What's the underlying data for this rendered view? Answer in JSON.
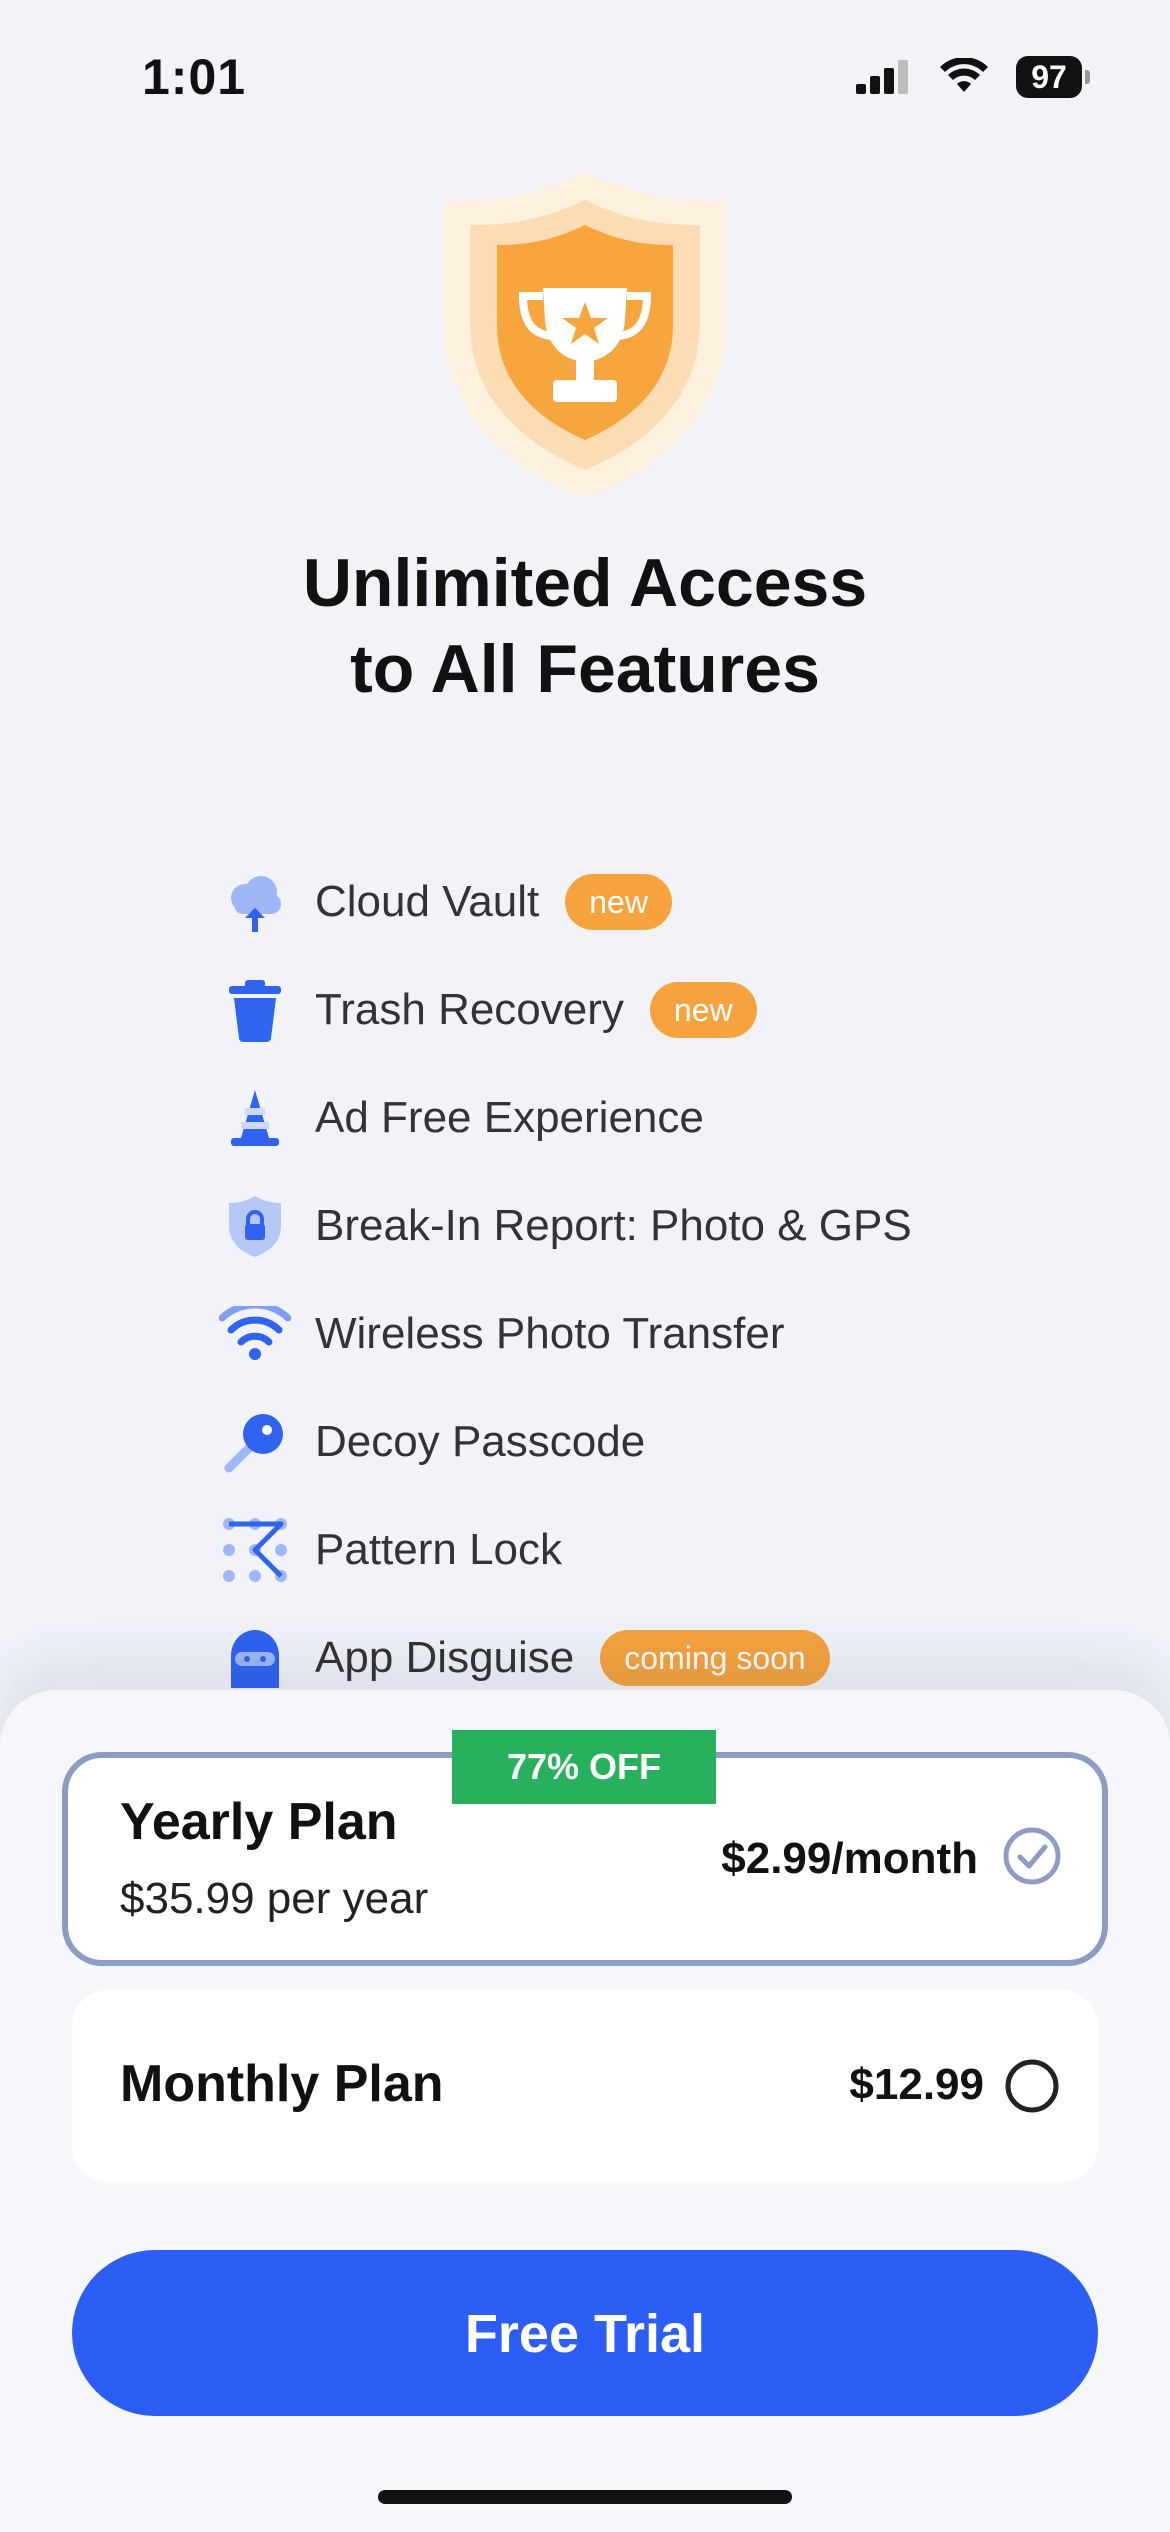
{
  "status_bar": {
    "time": "1:01",
    "battery": "97"
  },
  "headline": {
    "line1": "Unlimited Access",
    "line2": "to All Features"
  },
  "features": [
    {
      "label": "Cloud Vault",
      "badge": "new",
      "icon": "cloud-upload-icon"
    },
    {
      "label": "Trash Recovery",
      "badge": "new",
      "icon": "trash-icon"
    },
    {
      "label": "Ad Free Experience",
      "badge": "",
      "icon": "traffic-cone-icon"
    },
    {
      "label": "Break-In Report: Photo & GPS",
      "badge": "",
      "icon": "shield-lock-icon"
    },
    {
      "label": "Wireless Photo Transfer",
      "badge": "",
      "icon": "wifi-icon"
    },
    {
      "label": "Decoy Passcode",
      "badge": "",
      "icon": "key-icon"
    },
    {
      "label": "Pattern Lock",
      "badge": "",
      "icon": "pattern-lock-icon"
    },
    {
      "label": "App Disguise",
      "badge": "coming soon",
      "icon": "disguise-mask-icon"
    }
  ],
  "plans": {
    "yearly": {
      "badge": "77% OFF",
      "title": "Yearly Plan",
      "subtitle": "$35.99 per year",
      "price": "$2.99/month",
      "selected": true
    },
    "monthly": {
      "title": "Monthly Plan",
      "price": "$12.99",
      "selected": false
    }
  },
  "cta": {
    "label": "Free Trial"
  },
  "colors": {
    "accent": "#2c5ef5",
    "badge_orange": "#f6a33d",
    "offer_green": "#27b15d",
    "icon_blue": "#2f63f0",
    "selected_border": "#8d9cc4"
  }
}
